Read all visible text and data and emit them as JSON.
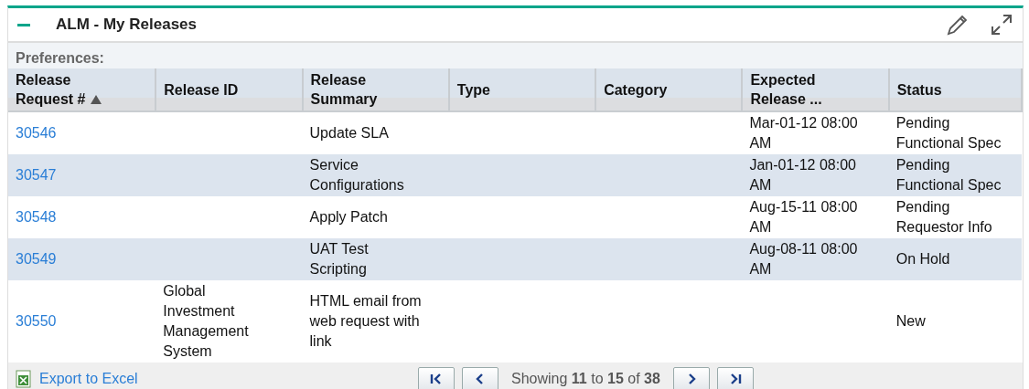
{
  "panel": {
    "title": "ALM - My Releases",
    "collapsed": false
  },
  "preferences_label": "Preferences:",
  "table": {
    "columns": [
      {
        "label": "Release Request #",
        "sorted": true
      },
      {
        "label": "Release ID",
        "sorted": false
      },
      {
        "label": "Release Summary",
        "sorted": false
      },
      {
        "label": "Type",
        "sorted": false
      },
      {
        "label": "Category",
        "sorted": false
      },
      {
        "label": "Expected Release ...",
        "sorted": false
      },
      {
        "label": "Status",
        "sorted": false
      }
    ],
    "rows": [
      {
        "request": "30546",
        "summary": "Update SLA",
        "expected": "Mar-01-12 08:00 AM",
        "status": "Pending Functional Spec"
      },
      {
        "request": "30547",
        "summary": "Service Configurations",
        "expected": "Jan-01-12 08:00 AM",
        "status": "Pending Functional Spec"
      },
      {
        "request": "30548",
        "summary": "Apply Patch",
        "expected": "Aug-15-11 08:00 AM",
        "status": "Pending Requestor Info"
      },
      {
        "request": "30549",
        "summary": "UAT Test Scripting",
        "expected": "Aug-08-11 08:00 AM",
        "status": "On Hold"
      },
      {
        "request": "30550",
        "release_id": "Global Investment Management System",
        "summary": "HTML email from web request with link",
        "status": "New"
      }
    ]
  },
  "footer": {
    "export_link": "Export to Excel",
    "paging": "Showing **11** to **15** of **38**"
  }
}
